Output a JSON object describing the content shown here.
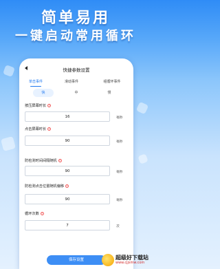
{
  "promo": {
    "headline": "简单易用",
    "subheadline": "一键启动常用循环"
  },
  "screen": {
    "title": "快捷参数设置",
    "tabs": [
      {
        "label": "单击事件",
        "active": true
      },
      {
        "label": "滑动事件",
        "active": false
      },
      {
        "label": "组循环事件",
        "active": false
      }
    ],
    "speed": [
      {
        "label": "快",
        "active": true
      },
      {
        "label": "中",
        "active": false
      },
      {
        "label": "慢",
        "active": false
      }
    ],
    "fields": [
      {
        "label": "按压屏幕时长",
        "value": "16",
        "unit": "毫秒"
      },
      {
        "label": "点击屏幕时长",
        "value": "90",
        "unit": "毫秒"
      },
      {
        "label": "防检测时间间隔随机",
        "value": "90",
        "unit": "毫秒"
      },
      {
        "label": "防检测点击位置随机偏移",
        "value": "90",
        "unit": "毫秒"
      },
      {
        "label": "循环次数",
        "value": "7",
        "unit": "次"
      }
    ],
    "help_glyph": "?",
    "save_label": "保存设置"
  },
  "watermark": {
    "name": "超级好下载站",
    "url": "www.cjjsmw.com"
  },
  "colors": {
    "accent": "#1e78f0",
    "button": "#3d8ef5",
    "help": "#f25a5a"
  }
}
